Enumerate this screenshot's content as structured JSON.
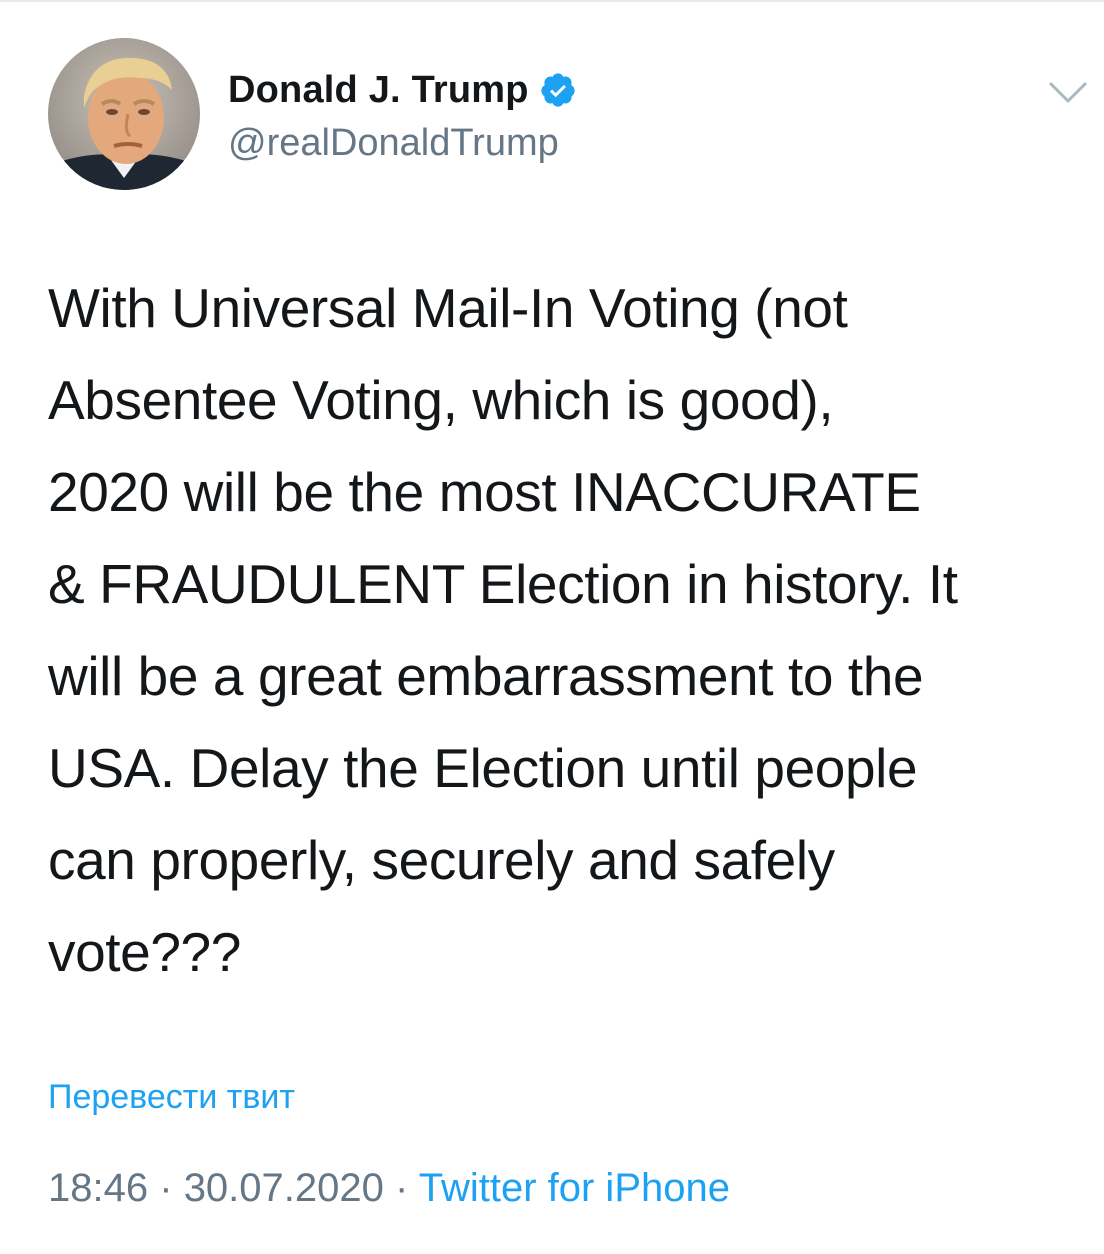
{
  "author": {
    "display_name": "Donald J. Trump",
    "handle": "@realDonaldTrump",
    "verified_icon": "verified-badge-icon",
    "avatar_icon": "profile-photo"
  },
  "menu": {
    "caret_icon": "chevron-down-icon"
  },
  "tweet": {
    "lines": [
      "With Universal Mail-In Voting (not",
      "Absentee Voting, which is good),",
      "2020 will be the most INACCURATE",
      "& FRAUDULENT Election in history. It",
      "will be a great embarrassment to the",
      "USA. Delay the Election until people",
      "can properly, securely and safely",
      "vote???"
    ]
  },
  "translate": {
    "label": "Перевести твит"
  },
  "meta": {
    "time": "18:46",
    "separator": "·",
    "date": "30.07.2020",
    "source": "Twitter for iPhone"
  },
  "colors": {
    "accent": "#1da1f2",
    "text": "#14171a",
    "secondary": "#657786"
  }
}
